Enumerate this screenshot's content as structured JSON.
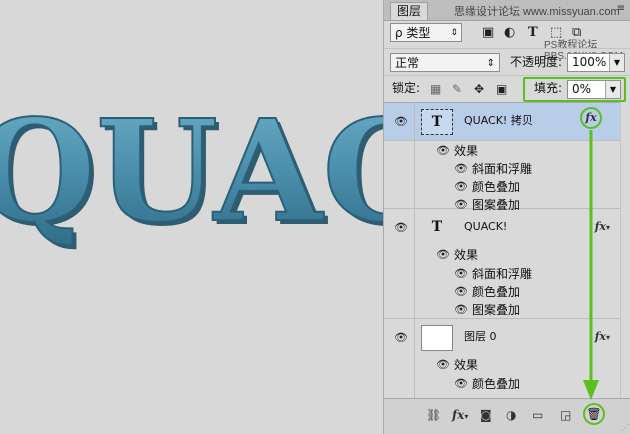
{
  "canvas": {
    "text": "QUACK",
    "fill_color": "#4f92b0",
    "shadow_color": "#1e4f66"
  },
  "panel": {
    "tab_label": "图层",
    "watermark": "思缘设计论坛 www.missyuan.com",
    "watermark2": "PS教程论坛 BBS.16XX8.COM",
    "tab_menu_icon": "panel-menu-icon"
  },
  "filter_bar": {
    "kind_label": "ρ 类型",
    "icons": [
      "image-filter-icon",
      "adjustment-filter-icon",
      "type-filter-icon",
      "shape-filter-icon",
      "smart-object-filter-icon"
    ]
  },
  "blend": {
    "mode": "正常",
    "opacity_label": "不透明度:",
    "opacity_value": "100%"
  },
  "lock": {
    "label": "锁定:",
    "icons": [
      "lock-transparent-icon",
      "lock-pixels-icon",
      "lock-position-icon",
      "lock-all-icon"
    ],
    "fill_label": "填充:",
    "fill_value": "0%"
  },
  "layers": [
    {
      "name": "QUACK! 拷贝",
      "thumb": "T",
      "selected": true,
      "fx": "fx",
      "effects_label": "效果",
      "effects": [
        "斜面和浮雕",
        "颜色叠加",
        "图案叠加"
      ]
    },
    {
      "name": "QUACK!",
      "thumb": "T",
      "selected": false,
      "fx": "fx",
      "effects_label": "效果",
      "effects": [
        "斜面和浮雕",
        "颜色叠加",
        "图案叠加"
      ]
    },
    {
      "name": "图层 0",
      "thumb": "",
      "selected": false,
      "fx": "fx",
      "effects_label": "效果",
      "effects": [
        "颜色叠加"
      ]
    }
  ],
  "bottom_bar": {
    "fx_label": "fx",
    "icons": [
      "link-layers-icon",
      "add-style-icon",
      "add-mask-icon",
      "new-adjustment-icon",
      "new-group-icon",
      "new-layer-icon",
      "delete-layer-icon"
    ]
  },
  "highlight_color": "#5bbf1e"
}
